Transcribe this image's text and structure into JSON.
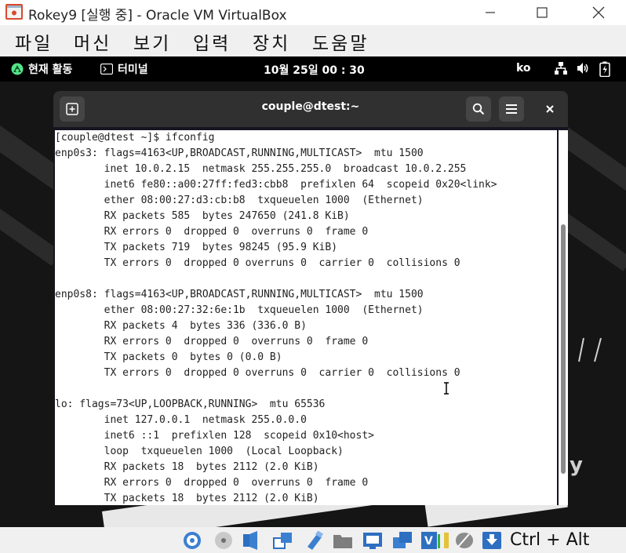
{
  "window": {
    "title": "Rokey9 [실행 중] - Oracle VM VirtualBox"
  },
  "menubar": {
    "items": [
      "파일",
      "머신",
      "보기",
      "입력",
      "장치",
      "도움말"
    ]
  },
  "guest": {
    "topbar": {
      "activities_label": "현재 활동",
      "app_label": "터미널",
      "clock": "10월 25일  00 : 30",
      "input_method": "ko"
    },
    "background_letter": "y"
  },
  "terminal": {
    "title": "couple@dtest:~",
    "lines": [
      "[couple@dtest ~]$ ifconfig",
      "enp0s3: flags=4163<UP,BROADCAST,RUNNING,MULTICAST>  mtu 1500",
      "        inet 10.0.2.15  netmask 255.255.255.0  broadcast 10.0.2.255",
      "        inet6 fe80::a00:27ff:fed3:cbb8  prefixlen 64  scopeid 0x20<link>",
      "        ether 08:00:27:d3:cb:b8  txqueuelen 1000  (Ethernet)",
      "        RX packets 585  bytes 247650 (241.8 KiB)",
      "        RX errors 0  dropped 0  overruns 0  frame 0",
      "        TX packets 719  bytes 98245 (95.9 KiB)",
      "        TX errors 0  dropped 0 overruns 0  carrier 0  collisions 0",
      "",
      "enp0s8: flags=4163<UP,BROADCAST,RUNNING,MULTICAST>  mtu 1500",
      "        ether 08:00:27:32:6e:1b  txqueuelen 1000  (Ethernet)",
      "        RX packets 4  bytes 336 (336.0 B)",
      "        RX errors 0  dropped 0  overruns 0  frame 0",
      "        TX packets 0  bytes 0 (0.0 B)",
      "        TX errors 0  dropped 0 overruns 0  carrier 0  collisions 0",
      "",
      "lo: flags=73<UP,LOOPBACK,RUNNING>  mtu 65536",
      "        inet 127.0.0.1  netmask 255.0.0.0",
      "        inet6 ::1  prefixlen 128  scopeid 0x10<host>",
      "        loop  txqueuelen 1000  (Local Loopback)",
      "        RX packets 18  bytes 2112 (2.0 KiB)",
      "        RX errors 0  dropped 0  overruns 0  frame 0",
      "        TX packets 18  bytes 2112 (2.0 KiB)"
    ]
  },
  "statusbar": {
    "host_key": "Ctrl + Alt",
    "icons": [
      "hard-disk-icon",
      "optical-drive-icon",
      "audio-icon",
      "network-icon",
      "usb-icon",
      "shared-folders-icon",
      "display-icon",
      "recording-icon",
      "virtualization-icon",
      "cpu-activity-icon",
      "mouse-integration-icon",
      "keyboard-capture-icon"
    ]
  },
  "colors": {
    "terminal_header": "#303030",
    "terminal_bg": "#ffffff",
    "gnome_topbar": "#000000",
    "host_chrome": "#f0f0f0"
  }
}
